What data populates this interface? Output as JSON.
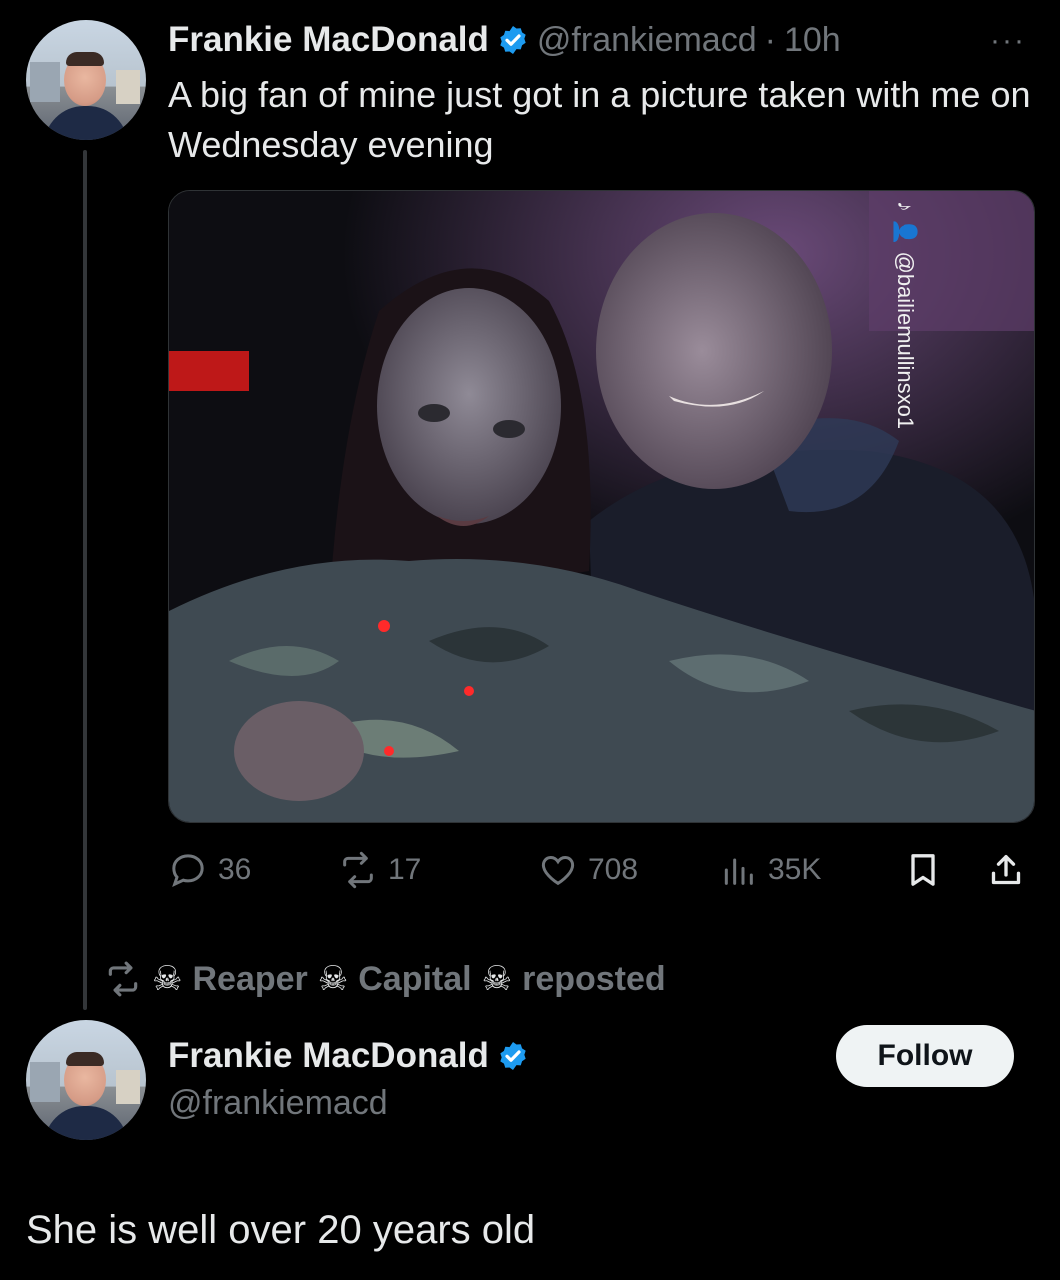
{
  "tweet": {
    "author_name": "Frankie MacDonald",
    "handle": "@frankiemacd",
    "separator": "·",
    "time": "10h",
    "more": "···",
    "text": "A big fan of mine just got in a picture taken with me on Wednesday evening",
    "photo_watermark": "♪ 👤 @bailiemullinsxo1",
    "stats": {
      "replies": "36",
      "reposts": "17",
      "likes": "708",
      "views": "35K"
    }
  },
  "repost_banner": {
    "skull": "☠",
    "name_part1": "Reaper",
    "name_part2": "Capital",
    "action": "reposted"
  },
  "profile_card": {
    "name": "Frankie MacDonald",
    "handle": "@frankiemacd",
    "follow_label": "Follow"
  },
  "caption": "She is well over 20 years old",
  "colors": {
    "background": "#000000",
    "text": "#e7e9ea",
    "muted": "#71767b",
    "verified": "#1d9bf0",
    "follow_bg": "#eff3f4"
  }
}
